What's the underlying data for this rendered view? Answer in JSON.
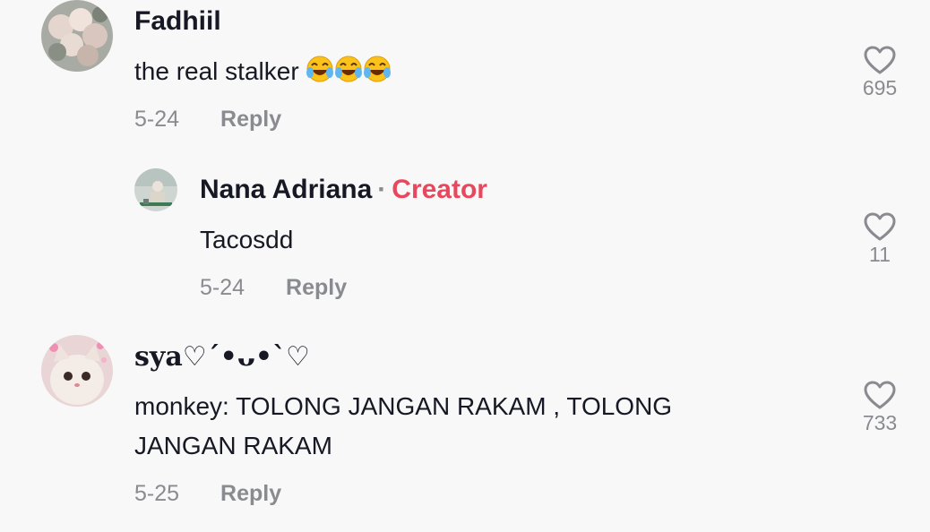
{
  "comments": [
    {
      "username": "Fadhiil",
      "text": "the real stalker",
      "emoji": "😂😂😂",
      "date": "5-24",
      "reply_label": "Reply",
      "likes": "695"
    },
    {
      "username": "Nana Adriana",
      "separator": "·",
      "badge": "Creator",
      "text": "Tacosdd",
      "date": "5-24",
      "reply_label": "Reply",
      "likes": "11"
    },
    {
      "username": "sya♡´•ᴗ•`♡",
      "text_line1": "monkey: TOLONG JANGAN RAKAM , TOLONG",
      "text_line2": "JANGAN RAKAM",
      "date": "5-25",
      "reply_label": "Reply",
      "likes": "733"
    }
  ],
  "colors": {
    "background": "#f8f8f8",
    "text_primary": "#161823",
    "text_secondary": "#8a8b91",
    "creator_badge": "#e8475e"
  },
  "icons": {
    "like": "heart-outline-icon",
    "emoji": "face-with-tears-of-joy"
  }
}
